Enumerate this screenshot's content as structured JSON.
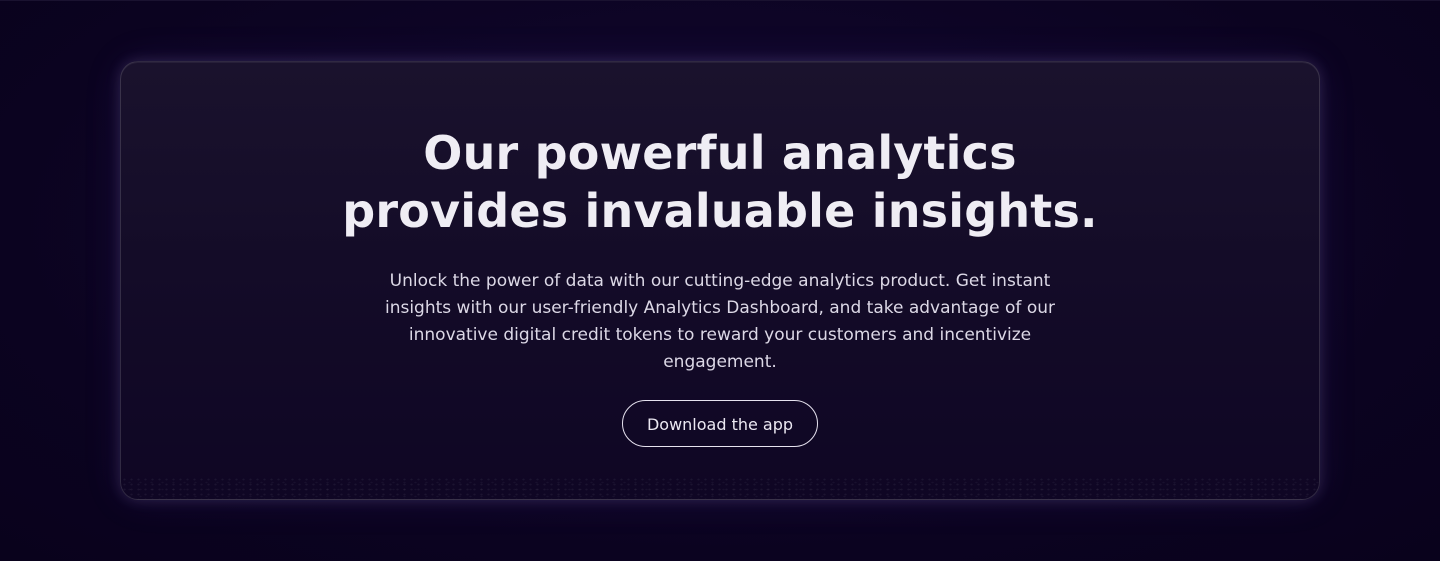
{
  "hero": {
    "title_lines": [
      "Our powerful analytics",
      "provides invaluable insights."
    ],
    "body_lines": [
      "Unlock the power of data with our cutting-edge analytics product. Get instant",
      "insights with our user-friendly Analytics Dashboard, and take advantage of our",
      "innovative digital credit tokens to reward your customers and incentivize",
      "engagement."
    ],
    "cta_label": "Download the app"
  },
  "colors": {
    "page_background": "#0c0423",
    "card_background": "#160e2a",
    "text_primary": "#efedf4",
    "text_secondary": "#dcd8e6",
    "button_border": "#e6e2ef"
  }
}
